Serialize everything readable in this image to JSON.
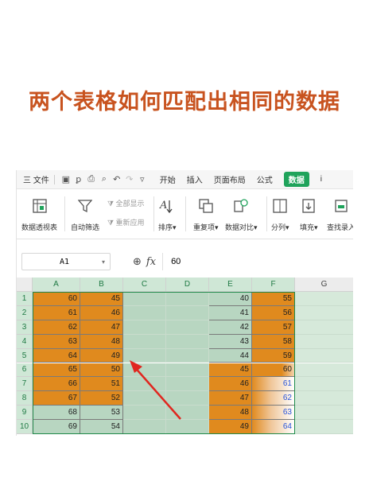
{
  "headline": "两个表格如何匹配出相同的数据",
  "menubar": {
    "file_label": "三 文件",
    "quick_icons": [
      "save-icon",
      "format-painter-icon",
      "print-icon",
      "print-preview-icon",
      "undo-icon",
      "redo-icon",
      "dropdown-icon"
    ],
    "tabs": [
      {
        "label": "开始",
        "active": false
      },
      {
        "label": "插入",
        "active": false
      },
      {
        "label": "页面布局",
        "active": false
      },
      {
        "label": "公式",
        "active": false
      },
      {
        "label": "数据",
        "active": true
      },
      {
        "label": "i",
        "active": false
      }
    ]
  },
  "ribbon": {
    "pivot": "数据透视表",
    "autofilter": "自动筛选",
    "show_all": "全部显示",
    "reapply": "重新应用",
    "sort": "排序",
    "duplicates": "重复项",
    "compare": "数据对比",
    "split": "分列",
    "fill": "填充",
    "find_entry": "查找录入",
    "colors": {
      "accent": "#1fa35b",
      "disabled": "#a8a8a8"
    }
  },
  "formula_bar": {
    "cell_ref": "A1",
    "fx_label": "fx",
    "value": "60"
  },
  "grid": {
    "columns": [
      "A",
      "B",
      "C",
      "D",
      "E",
      "F",
      "G"
    ],
    "selected_columns": [
      "A",
      "B",
      "C",
      "D",
      "E",
      "F"
    ],
    "rows": [
      "1",
      "2",
      "3",
      "4",
      "5",
      "6",
      "7",
      "8",
      "9",
      "10"
    ],
    "colA": [
      "60",
      "61",
      "62",
      "63",
      "64",
      "65",
      "66",
      "67",
      "68",
      "69"
    ],
    "colB": [
      "45",
      "46",
      "47",
      "48",
      "49",
      "50",
      "51",
      "52",
      "53",
      "54"
    ],
    "colE": [
      "40",
      "41",
      "42",
      "43",
      "44",
      "45",
      "46",
      "47",
      "48",
      "49"
    ],
    "colF": [
      "55",
      "56",
      "57",
      "58",
      "59",
      "60",
      "61",
      "62",
      "63",
      "64"
    ],
    "highlightA": [
      true,
      true,
      true,
      true,
      true,
      true,
      true,
      true,
      false,
      false
    ],
    "highlightB": [
      true,
      true,
      true,
      true,
      true,
      true,
      true,
      true,
      false,
      false
    ],
    "highlightE": [
      false,
      false,
      false,
      false,
      false,
      true,
      true,
      true,
      true,
      true
    ],
    "highlightF": [
      true,
      true,
      true,
      true,
      true,
      true,
      false,
      false,
      false,
      false
    ],
    "colors": {
      "highlight": "#e08a1e",
      "selection": "#b8d6c1",
      "selection_header": "#cfe7d6",
      "plain_cell": "#d6e9da",
      "arrow": "#e0261f"
    }
  }
}
